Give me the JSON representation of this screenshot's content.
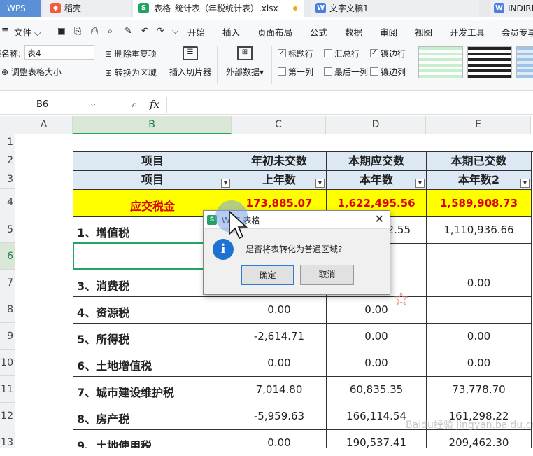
{
  "tabs": [
    {
      "label": "WPS"
    },
    {
      "label": "稻壳"
    },
    {
      "label": "表格_统计表（年税统计表）.xlsx"
    },
    {
      "label": "文字文稿1"
    },
    {
      "label": "INDIRE"
    }
  ],
  "menu": {
    "file": "文件",
    "items": [
      "开始",
      "插入",
      "页面布局",
      "公式",
      "数据",
      "审阅",
      "视图",
      "开发工具",
      "会员专享"
    ]
  },
  "ribbon": {
    "table_name_label": "表名称:",
    "table_name_value": "表4",
    "resize": "调整表格大小",
    "remove_dup": "删除重复项",
    "to_range": "转换为区域",
    "slicer": "插入切片器",
    "external": "外部数据",
    "checks": [
      {
        "label": "标题行",
        "checked": true
      },
      {
        "label": "汇总行",
        "checked": false
      },
      {
        "label": "镶边行",
        "checked": true
      },
      {
        "label": "第一列",
        "checked": false
      },
      {
        "label": "最后一列",
        "checked": false
      },
      {
        "label": "镶边列",
        "checked": false
      }
    ]
  },
  "formula_bar": {
    "cell_ref": "B6",
    "fx": "fx",
    "value": ""
  },
  "columns": [
    "A",
    "B",
    "C",
    "D",
    "E"
  ],
  "rows": [
    "1",
    "2",
    "3",
    "4",
    "5",
    "6",
    "7",
    "8",
    "9",
    "10",
    "11",
    "12",
    "13"
  ],
  "table": {
    "h1": [
      "项目",
      "年初未交数",
      "本期应交数",
      "本期已交数"
    ],
    "h2": [
      "项目",
      "上年数",
      "本年数",
      "本年数2"
    ],
    "total": [
      "应交税金",
      "173,885.07",
      "1,622,495.56",
      "1,589,908.73"
    ],
    "body": [
      [
        "1、增值税",
        "",
        "1,…2.55",
        "1,110,936.66"
      ],
      [
        "",
        "",
        "",
        ""
      ],
      [
        "3、消费税",
        "",
        "",
        "0.00"
      ],
      [
        "4、资源税",
        "0.00",
        "0.00",
        ""
      ],
      [
        "5、所得税",
        "-2,614.71",
        "0.00",
        "0.00"
      ],
      [
        "6、土地增值税",
        "0.00",
        "0.00",
        "0.00"
      ],
      [
        "7、城市建设维护税",
        "7,014.80",
        "60,835.35",
        "73,778.70"
      ],
      [
        "8、房产税",
        "-5,959.63",
        "166,114.54",
        "161,298.22"
      ],
      [
        "9、土地使用税",
        "0.00",
        "190,537.41",
        "209,462.30"
      ]
    ]
  },
  "dialog": {
    "title": "WPS 表格",
    "message": "是否将表转化为普通区域?",
    "ok": "确定",
    "cancel": "取消"
  },
  "watermark": "Baidu经验 jingyan.baidu.com",
  "colors": {
    "accent": "#21a366",
    "highlight": "#ffff00",
    "red_text": "#e00000",
    "header_fill": "#dde8f5"
  }
}
